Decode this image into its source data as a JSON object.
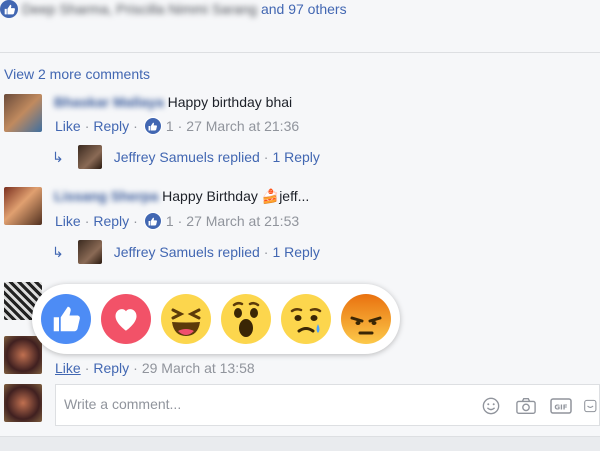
{
  "likes": {
    "names_blurred": "Deep Sharma, Priscilla Nimmi Sarang",
    "others_text": "and 97 others"
  },
  "view_more": "View 2 more comments",
  "comments": [
    {
      "author_blurred": "Bhaskar Mallaya",
      "text": "Happy birthday bhai",
      "like": "Like",
      "reply": "Reply",
      "like_count": "1",
      "time": "27 March at 21:36",
      "replied_text": "Jeffrey Samuels replied",
      "reply_count": "1 Reply"
    },
    {
      "author_blurred": "Lissang Sherpa",
      "text": "Happy Birthday 🍰jeff...",
      "like": "Like",
      "reply": "Reply",
      "like_count": "1",
      "time": "27 March at 21:53",
      "replied_text": "Jeffrey Samuels replied",
      "reply_count": "1 Reply"
    },
    {
      "like": "Like",
      "reply": "Reply",
      "time": "29 March at 13:58"
    }
  ],
  "reactions": [
    "like-icon",
    "love-icon",
    "haha-icon",
    "wow-icon",
    "sad-icon",
    "angry-icon"
  ],
  "composer": {
    "placeholder": "Write a comment..."
  },
  "composer_icons": [
    "emoji-icon",
    "camera-icon",
    "gif-icon",
    "sticker-icon"
  ],
  "colors": {
    "link": "#4267b2",
    "meta": "#90949c",
    "love": "#f25268",
    "angry": "#e9710f",
    "emoji": "#fcd64d"
  }
}
